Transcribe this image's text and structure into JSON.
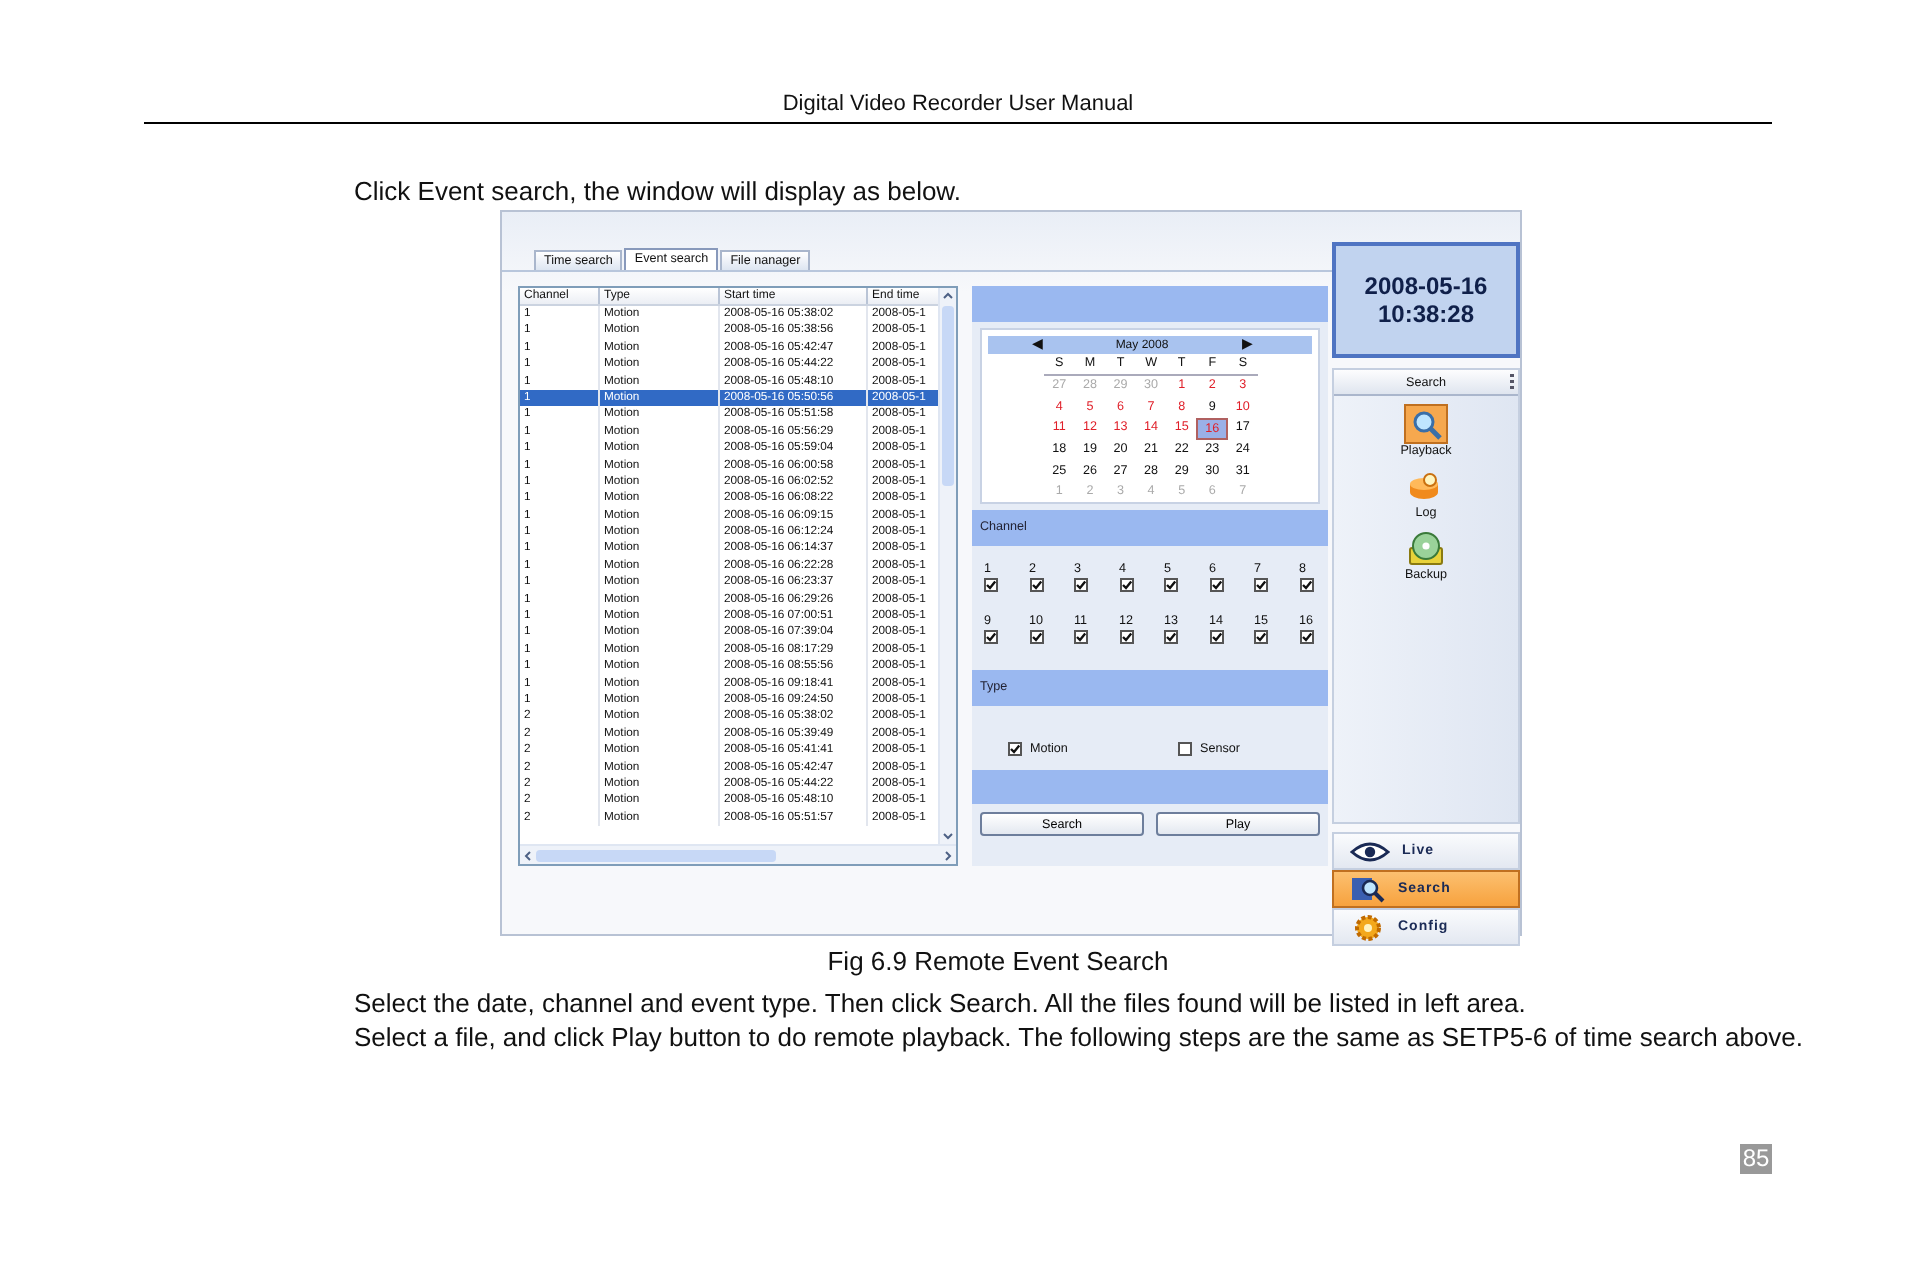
{
  "header": "Digital Video Recorder User Manual",
  "intro": "Click Event search, the window will display as below.",
  "window": {
    "tabs": [
      {
        "label": "Time search",
        "selected": false
      },
      {
        "label": "Event search",
        "selected": true
      },
      {
        "label": "File nanager",
        "selected": false
      }
    ],
    "table": {
      "columns": [
        "Channel",
        "Type",
        "Start time",
        "End time"
      ],
      "rows": [
        {
          "cells": [
            "1",
            "Motion",
            "2008-05-16 05:38:02",
            "2008-05-1"
          ],
          "selected": false
        },
        {
          "cells": [
            "1",
            "Motion",
            "2008-05-16 05:38:56",
            "2008-05-1"
          ],
          "selected": false
        },
        {
          "cells": [
            "1",
            "Motion",
            "2008-05-16 05:42:47",
            "2008-05-1"
          ],
          "selected": false
        },
        {
          "cells": [
            "1",
            "Motion",
            "2008-05-16 05:44:22",
            "2008-05-1"
          ],
          "selected": false
        },
        {
          "cells": [
            "1",
            "Motion",
            "2008-05-16 05:48:10",
            "2008-05-1"
          ],
          "selected": false
        },
        {
          "cells": [
            "1",
            "Motion",
            "2008-05-16 05:50:56",
            "2008-05-1"
          ],
          "selected": true
        },
        {
          "cells": [
            "1",
            "Motion",
            "2008-05-16 05:51:58",
            "2008-05-1"
          ],
          "selected": false
        },
        {
          "cells": [
            "1",
            "Motion",
            "2008-05-16 05:56:29",
            "2008-05-1"
          ],
          "selected": false
        },
        {
          "cells": [
            "1",
            "Motion",
            "2008-05-16 05:59:04",
            "2008-05-1"
          ],
          "selected": false
        },
        {
          "cells": [
            "1",
            "Motion",
            "2008-05-16 06:00:58",
            "2008-05-1"
          ],
          "selected": false
        },
        {
          "cells": [
            "1",
            "Motion",
            "2008-05-16 06:02:52",
            "2008-05-1"
          ],
          "selected": false
        },
        {
          "cells": [
            "1",
            "Motion",
            "2008-05-16 06:08:22",
            "2008-05-1"
          ],
          "selected": false
        },
        {
          "cells": [
            "1",
            "Motion",
            "2008-05-16 06:09:15",
            "2008-05-1"
          ],
          "selected": false
        },
        {
          "cells": [
            "1",
            "Motion",
            "2008-05-16 06:12:24",
            "2008-05-1"
          ],
          "selected": false
        },
        {
          "cells": [
            "1",
            "Motion",
            "2008-05-16 06:14:37",
            "2008-05-1"
          ],
          "selected": false
        },
        {
          "cells": [
            "1",
            "Motion",
            "2008-05-16 06:22:28",
            "2008-05-1"
          ],
          "selected": false
        },
        {
          "cells": [
            "1",
            "Motion",
            "2008-05-16 06:23:37",
            "2008-05-1"
          ],
          "selected": false
        },
        {
          "cells": [
            "1",
            "Motion",
            "2008-05-16 06:29:26",
            "2008-05-1"
          ],
          "selected": false
        },
        {
          "cells": [
            "1",
            "Motion",
            "2008-05-16 07:00:51",
            "2008-05-1"
          ],
          "selected": false
        },
        {
          "cells": [
            "1",
            "Motion",
            "2008-05-16 07:39:04",
            "2008-05-1"
          ],
          "selected": false
        },
        {
          "cells": [
            "1",
            "Motion",
            "2008-05-16 08:17:29",
            "2008-05-1"
          ],
          "selected": false
        },
        {
          "cells": [
            "1",
            "Motion",
            "2008-05-16 08:55:56",
            "2008-05-1"
          ],
          "selected": false
        },
        {
          "cells": [
            "1",
            "Motion",
            "2008-05-16 09:18:41",
            "2008-05-1"
          ],
          "selected": false
        },
        {
          "cells": [
            "1",
            "Motion",
            "2008-05-16 09:24:50",
            "2008-05-1"
          ],
          "selected": false
        },
        {
          "cells": [
            "2",
            "Motion",
            "2008-05-16 05:38:02",
            "2008-05-1"
          ],
          "selected": false
        },
        {
          "cells": [
            "2",
            "Motion",
            "2008-05-16 05:39:49",
            "2008-05-1"
          ],
          "selected": false
        },
        {
          "cells": [
            "2",
            "Motion",
            "2008-05-16 05:41:41",
            "2008-05-1"
          ],
          "selected": false
        },
        {
          "cells": [
            "2",
            "Motion",
            "2008-05-16 05:42:47",
            "2008-05-1"
          ],
          "selected": false
        },
        {
          "cells": [
            "2",
            "Motion",
            "2008-05-16 05:44:22",
            "2008-05-1"
          ],
          "selected": false
        },
        {
          "cells": [
            "2",
            "Motion",
            "2008-05-16 05:48:10",
            "2008-05-1"
          ],
          "selected": false
        },
        {
          "cells": [
            "2",
            "Motion",
            "2008-05-16 05:51:57",
            "2008-05-1"
          ],
          "selected": false
        }
      ]
    },
    "calendar": {
      "prev": "◀",
      "month": "May 2008",
      "next": "▶",
      "weekdays": [
        "S",
        "M",
        "T",
        "W",
        "T",
        "F",
        "S"
      ],
      "weeks": [
        [
          {
            "day": "27",
            "kind": "other",
            "selected": false
          },
          {
            "day": "28",
            "kind": "other",
            "selected": false
          },
          {
            "day": "29",
            "kind": "other",
            "selected": false
          },
          {
            "day": "30",
            "kind": "other",
            "selected": false
          },
          {
            "day": "1",
            "kind": "marked",
            "selected": false
          },
          {
            "day": "2",
            "kind": "marked",
            "selected": false
          },
          {
            "day": "3",
            "kind": "marked",
            "selected": false
          }
        ],
        [
          {
            "day": "4",
            "kind": "marked",
            "selected": false
          },
          {
            "day": "5",
            "kind": "marked",
            "selected": false
          },
          {
            "day": "6",
            "kind": "marked",
            "selected": false
          },
          {
            "day": "7",
            "kind": "marked",
            "selected": false
          },
          {
            "day": "8",
            "kind": "marked",
            "selected": false
          },
          {
            "day": "9",
            "kind": "normal",
            "selected": false
          },
          {
            "day": "10",
            "kind": "marked",
            "selected": false
          }
        ],
        [
          {
            "day": "11",
            "kind": "marked",
            "selected": false
          },
          {
            "day": "12",
            "kind": "marked",
            "selected": false
          },
          {
            "day": "13",
            "kind": "marked",
            "selected": false
          },
          {
            "day": "14",
            "kind": "marked",
            "selected": false
          },
          {
            "day": "15",
            "kind": "marked",
            "selected": false
          },
          {
            "day": "16",
            "kind": "marked",
            "selected": true
          },
          {
            "day": "17",
            "kind": "normal",
            "selected": false
          }
        ],
        [
          {
            "day": "18",
            "kind": "normal",
            "selected": false
          },
          {
            "day": "19",
            "kind": "normal",
            "selected": false
          },
          {
            "day": "20",
            "kind": "normal",
            "selected": false
          },
          {
            "day": "21",
            "kind": "normal",
            "selected": false
          },
          {
            "day": "22",
            "kind": "normal",
            "selected": false
          },
          {
            "day": "23",
            "kind": "normal",
            "selected": false
          },
          {
            "day": "24",
            "kind": "normal",
            "selected": false
          }
        ],
        [
          {
            "day": "25",
            "kind": "normal",
            "selected": false
          },
          {
            "day": "26",
            "kind": "normal",
            "selected": false
          },
          {
            "day": "27",
            "kind": "normal",
            "selected": false
          },
          {
            "day": "28",
            "kind": "normal",
            "selected": false
          },
          {
            "day": "29",
            "kind": "normal",
            "selected": false
          },
          {
            "day": "30",
            "kind": "normal",
            "selected": false
          },
          {
            "day": "31",
            "kind": "normal",
            "selected": false
          }
        ],
        [
          {
            "day": "1",
            "kind": "other",
            "selected": false
          },
          {
            "day": "2",
            "kind": "other",
            "selected": false
          },
          {
            "day": "3",
            "kind": "other",
            "selected": false
          },
          {
            "day": "4",
            "kind": "other",
            "selected": false
          },
          {
            "day": "5",
            "kind": "other",
            "selected": false
          },
          {
            "day": "6",
            "kind": "other",
            "selected": false
          },
          {
            "day": "7",
            "kind": "other",
            "selected": false
          }
        ]
      ]
    },
    "channel_section": {
      "title": "Channel",
      "channels": [
        {
          "label": "1",
          "checked": true
        },
        {
          "label": "2",
          "checked": true
        },
        {
          "label": "3",
          "checked": true
        },
        {
          "label": "4",
          "checked": true
        },
        {
          "label": "5",
          "checked": true
        },
        {
          "label": "6",
          "checked": true
        },
        {
          "label": "7",
          "checked": true
        },
        {
          "label": "8",
          "checked": true
        },
        {
          "label": "9",
          "checked": true
        },
        {
          "label": "10",
          "checked": true
        },
        {
          "label": "11",
          "checked": true
        },
        {
          "label": "12",
          "checked": true
        },
        {
          "label": "13",
          "checked": true
        },
        {
          "label": "14",
          "checked": true
        },
        {
          "label": "15",
          "checked": true
        },
        {
          "label": "16",
          "checked": true
        }
      ]
    },
    "type_section": {
      "title": "Type",
      "options": [
        {
          "label": "Motion",
          "checked": true
        },
        {
          "label": "Sensor",
          "checked": false
        }
      ]
    },
    "buttons": [
      "Search",
      "Play"
    ],
    "clock": {
      "date": "2008-05-16",
      "time": "10:38:28"
    },
    "tools": {
      "title": "Search",
      "items": [
        {
          "label": "Playback",
          "kind": "playback",
          "selected": true
        },
        {
          "label": "Log",
          "kind": "log",
          "selected": false
        },
        {
          "label": "Backup",
          "kind": "backup",
          "selected": false
        }
      ]
    },
    "nav": [
      {
        "label": "Live",
        "kind": "live",
        "selected": false
      },
      {
        "label": "Search",
        "kind": "search",
        "selected": true
      },
      {
        "label": "Config",
        "kind": "config",
        "selected": false
      }
    ]
  },
  "caption": "Fig 6.9 Remote Event Search",
  "paragraphs": [
    "Select the date, channel and event type. Then click Search. All the files found will be listed in left area.",
    "Select a file, and click Play button to do remote playback. The following steps are the same as SETP5-6 of time search above."
  ],
  "page_number": "85"
}
